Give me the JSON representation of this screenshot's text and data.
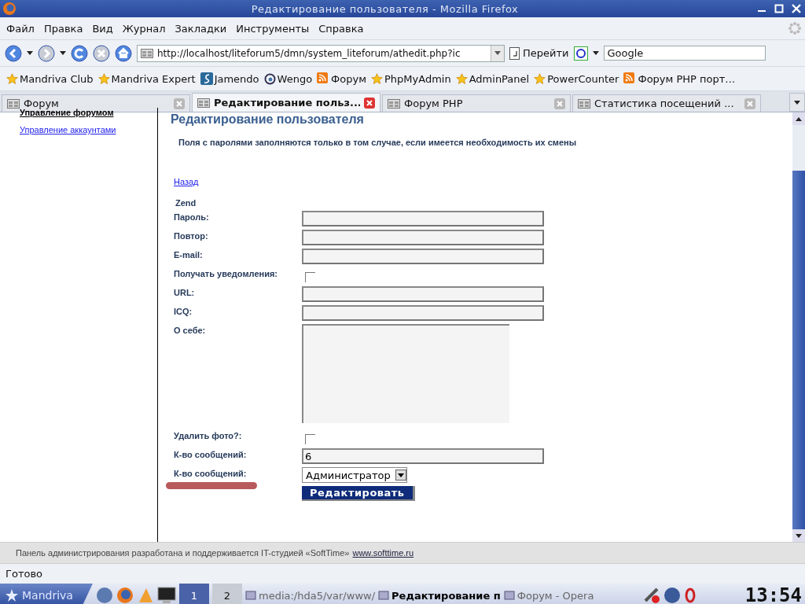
{
  "window": {
    "title": "Редактирование пользователя - Mozilla Firefox"
  },
  "menu": [
    "Файл",
    "Правка",
    "Вид",
    "Журнал",
    "Закладки",
    "Инструменты",
    "Справка"
  ],
  "navbar": {
    "url": "http://localhost/liteforum5/dmn/system_liteforum/athedit.php?ic",
    "go": "Перейти",
    "search": "Google"
  },
  "bookmarks": [
    {
      "kind": "star",
      "label": "Mandriva Club"
    },
    {
      "kind": "star",
      "label": "Mandriva Expert"
    },
    {
      "kind": "logo",
      "label": "Jamendo"
    },
    {
      "kind": "globe",
      "label": "Wengo"
    },
    {
      "kind": "feed",
      "label": "Форум"
    },
    {
      "kind": "star",
      "label": "PhpMyAdmin"
    },
    {
      "kind": "star",
      "label": "AdminPanel"
    },
    {
      "kind": "star",
      "label": "PowerCounter"
    },
    {
      "kind": "feed",
      "label": "Форум PHP порт…"
    }
  ],
  "tabs": [
    {
      "label": "Форум",
      "selected": false
    },
    {
      "label": "Редактирование польз...",
      "selected": true
    },
    {
      "label": "Форум PHP",
      "selected": false
    },
    {
      "label": "Статистика посещений  ...",
      "selected": false
    }
  ],
  "sidebar": {
    "items": [
      {
        "label": "Управление форумом",
        "selected": true
      },
      {
        "label": "Управление аккаунтами",
        "selected": false
      }
    ]
  },
  "page": {
    "heading": "Редактирование пользователя",
    "note": "Поля с паролями заполняются только в том случае, если имеется необходимость их смены",
    "back": "Назад",
    "username": "Zend",
    "fields": [
      {
        "kind": "text",
        "label": "Пароль:"
      },
      {
        "kind": "text",
        "label": "Повтор:"
      },
      {
        "kind": "text",
        "label": "E-mail:"
      },
      {
        "kind": "checkbox",
        "label": "Получать уведомления:",
        "checked": false
      },
      {
        "kind": "text",
        "label": "URL:"
      },
      {
        "kind": "text",
        "label": "ICQ:"
      },
      {
        "kind": "textarea",
        "label": "О себе:"
      },
      {
        "kind": "checkbox",
        "label": "Удалить фото?:",
        "checked": false
      },
      {
        "kind": "text",
        "label": "К-во сообщений:",
        "value": "6"
      },
      {
        "kind": "select",
        "label": "К-во сообщений:",
        "value": "Администратор",
        "highlighted": true
      }
    ],
    "submit": "Редактировать",
    "footer": {
      "text": "Панель администрирования разработана и поддерживается IT-студией «SoftTime»",
      "link": "www.softtime.ru"
    }
  },
  "status_bar": "Готово",
  "taskbar": {
    "start": "Mandriva",
    "desktops": [
      {
        "label": "1",
        "selected": true
      },
      {
        "label": "2",
        "selected": false
      }
    ],
    "tasks": [
      {
        "label": "media:/hda5/var/www/",
        "active": false
      },
      {
        "label": "Редактирование п",
        "active": true
      },
      {
        "label": "Форум - Opera",
        "active": false
      }
    ],
    "clock": "13:54"
  }
}
